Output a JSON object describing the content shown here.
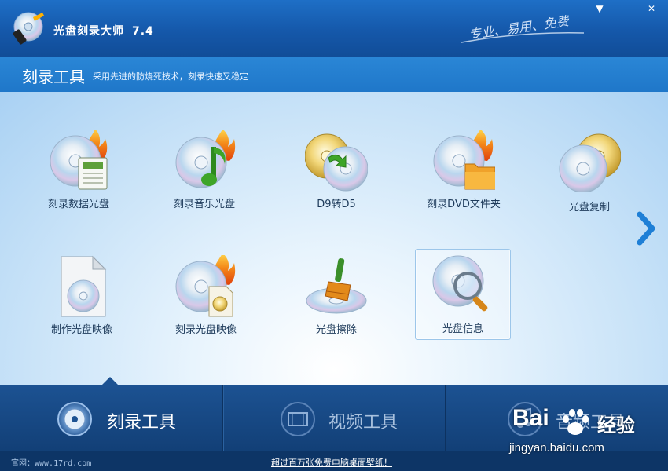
{
  "app": {
    "title": "光盘刻录大师",
    "version": "7.4",
    "slogan": "专业、易用、免费"
  },
  "window_controls": {
    "menu": "▼",
    "minimize": "—",
    "close": "✕"
  },
  "section": {
    "title": "刻录工具",
    "description": "采用先进的防烧死技术，刻录快速又稳定"
  },
  "tools": [
    {
      "label": "刻录数据光盘",
      "icon": "burn-data-disc-icon"
    },
    {
      "label": "刻录音乐光盘",
      "icon": "burn-music-disc-icon"
    },
    {
      "label": "D9转D5",
      "icon": "d9-to-d5-icon"
    },
    {
      "label": "刻录DVD文件夹",
      "icon": "burn-dvd-folder-icon"
    },
    {
      "label": "光盘复制",
      "icon": "disc-copy-icon"
    },
    {
      "label": "制作光盘映像",
      "icon": "make-disc-image-icon"
    },
    {
      "label": "刻录光盘映像",
      "icon": "burn-disc-image-icon"
    },
    {
      "label": "光盘擦除",
      "icon": "disc-erase-icon"
    },
    {
      "label": "光盘信息",
      "icon": "disc-info-icon"
    }
  ],
  "bottom_nav": [
    {
      "label": "刻录工具",
      "icon": "disc-burn-icon",
      "active": true
    },
    {
      "label": "视频工具",
      "icon": "film-icon",
      "active": false
    },
    {
      "label": "音频工具",
      "icon": "music-note-icon",
      "active": false
    }
  ],
  "status": {
    "site": "官网：www.17rd.com",
    "ad": "超过百万张免费电脑桌面壁纸！"
  },
  "watermark": {
    "brand": "Bai",
    "cn": "经验",
    "url": "jingyan.baidu.com"
  },
  "colors": {
    "title_bar": "#1558aa",
    "section_header": "#1f77c9",
    "bottom_nav": "#1c5292",
    "accent_arrow": "#1e7fd6"
  }
}
